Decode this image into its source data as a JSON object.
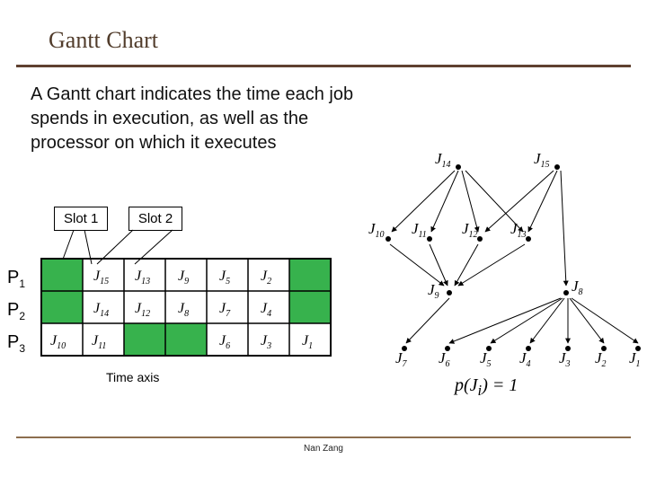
{
  "title": "Gantt Chart",
  "description": "A Gantt chart indicates the time each job spends in execution, as well as the processor on which it executes",
  "slot_labels": {
    "s1": "Slot 1",
    "s2": "Slot 2"
  },
  "processors": {
    "p1": "P",
    "p1s": "1",
    "p2": "P",
    "p2s": "2",
    "p3": "P",
    "p3s": "3"
  },
  "time_axis_label": "Time axis",
  "footer": "Nan Zang",
  "pJ": "p(J",
  "pJsub": "i",
  "pJtail": ") = 1",
  "chart_data": {
    "type": "gantt",
    "slot_count": 7,
    "rows": [
      {
        "processor": "P1",
        "cells": [
          "",
          "J15",
          "J13",
          "J9",
          "J5",
          "J2",
          ""
        ]
      },
      {
        "processor": "P2",
        "cells": [
          "",
          "J14",
          "J12",
          "J8",
          "J7",
          "J4",
          ""
        ]
      },
      {
        "processor": "P3",
        "cells": [
          "J10",
          "J11",
          "",
          "",
          "J6",
          "J3",
          "J1"
        ]
      }
    ],
    "green_indices": {
      "P1": [
        0,
        6
      ],
      "P2": [
        0,
        6
      ],
      "P3": [
        2,
        3
      ]
    }
  },
  "gantt": {
    "r1": {
      "c2": "J",
      "c2s": "15",
      "c3": "J",
      "c3s": "13",
      "c4": "J",
      "c4s": "9",
      "c5": "J",
      "c5s": "5",
      "c6": "J",
      "c6s": "2"
    },
    "r2": {
      "c2": "J",
      "c2s": "14",
      "c3": "J",
      "c3s": "12",
      "c4": "J",
      "c4s": "8",
      "c5": "J",
      "c5s": "7",
      "c6": "J",
      "c6s": "4"
    },
    "r3": {
      "c1": "J",
      "c1s": "10",
      "c2": "J",
      "c2s": "11",
      "c5": "J",
      "c5s": "6",
      "c6": "J",
      "c6s": "3",
      "c7": "J",
      "c7s": "1"
    }
  },
  "tree": {
    "n14": "J",
    "n14s": "14",
    "n15": "J",
    "n15s": "15",
    "n10": "J",
    "n10s": "10",
    "n11": "J",
    "n11s": "11",
    "n12": "J",
    "n12s": "12",
    "n13": "J",
    "n13s": "13",
    "n9": "J",
    "n9s": "9",
    "n8": "J",
    "n8s": "8",
    "n7": "J",
    "n7s": "7",
    "n6": "J",
    "n6s": "6",
    "n5": "J",
    "n5s": "5",
    "n4": "J",
    "n4s": "4",
    "n3": "J",
    "n3s": "3",
    "n2": "J",
    "n2s": "2",
    "n1": "J",
    "n1s": "1"
  }
}
